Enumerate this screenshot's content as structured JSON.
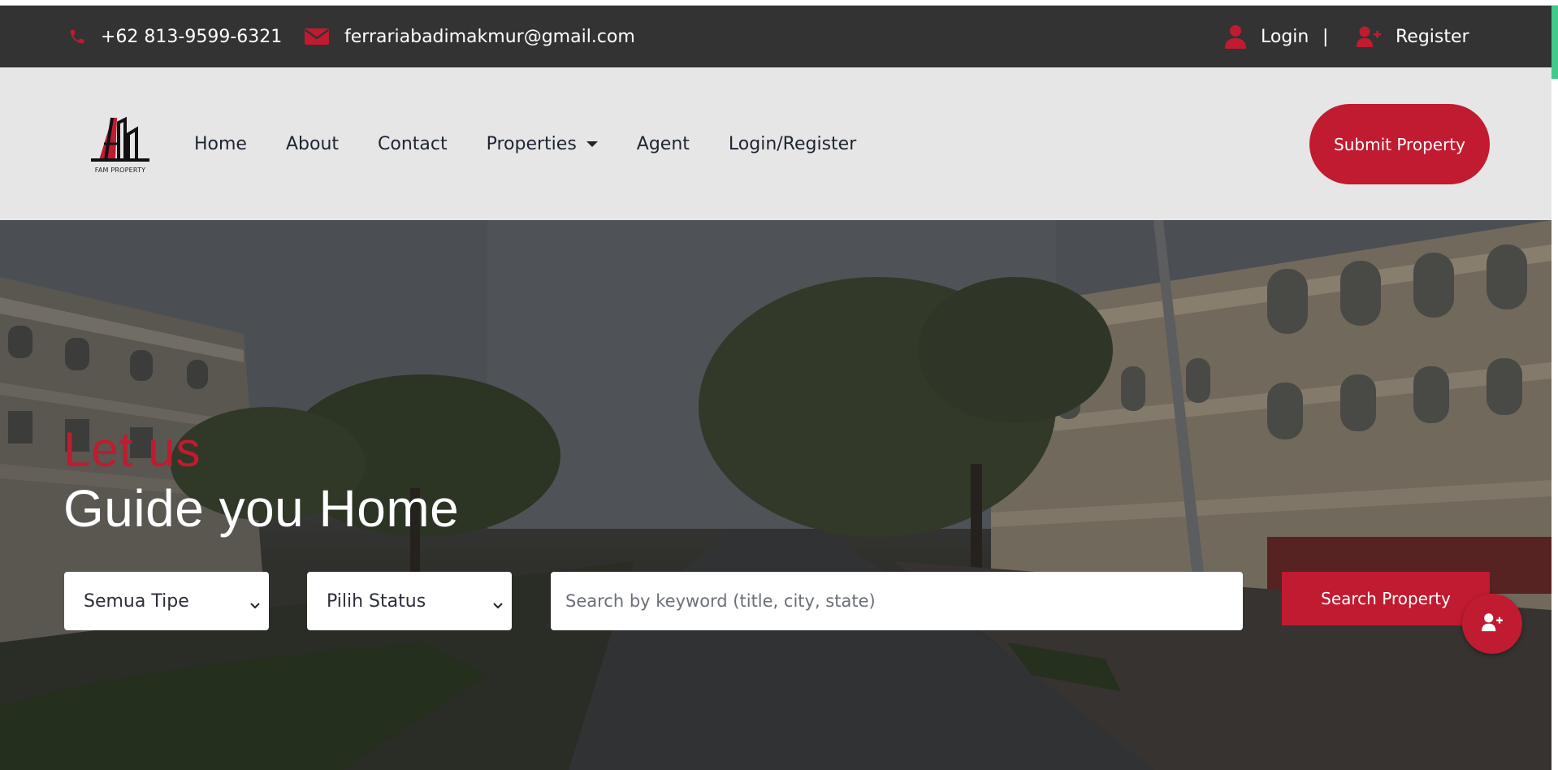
{
  "topbar": {
    "phone": "+62 813-9599-6321",
    "email": "ferrariabadimakmur@gmail.com",
    "login": "Login",
    "separator": "|",
    "register": "Register",
    "icon_color": "#c01b30"
  },
  "nav": {
    "logo_text": "FAM PROPERTY",
    "links": [
      "Home",
      "About",
      "Contact",
      "Properties",
      "Agent",
      "Login/Register"
    ],
    "submit": "Submit Property"
  },
  "hero": {
    "title_line1": "Let us",
    "title_line2": "Guide you Home",
    "type_select": "Semua Tipe",
    "status_select": "Pilih Status",
    "search_placeholder": "Search by keyword (title, city, state)",
    "search_button": "Search Property"
  },
  "colors": {
    "accent": "#c01b30",
    "topbar_bg": "#333333",
    "navbar_bg": "#e6e6e6"
  }
}
